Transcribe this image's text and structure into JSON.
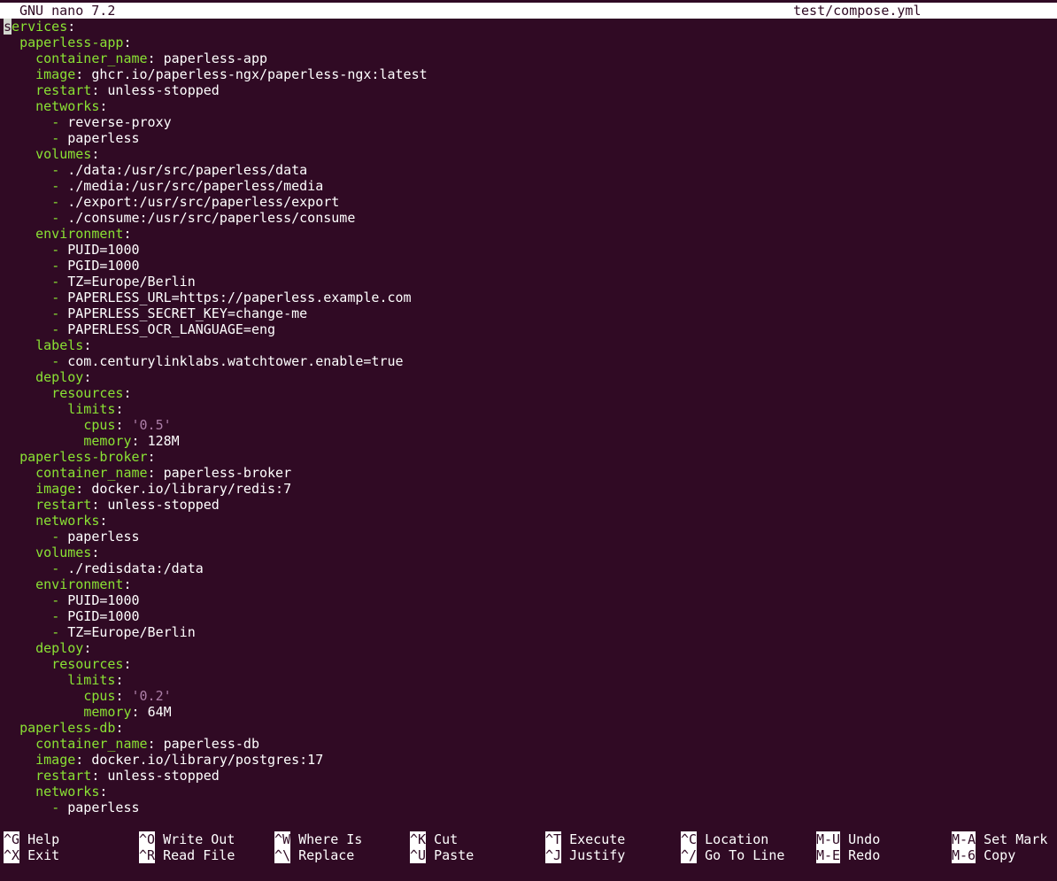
{
  "titlebar": {
    "app": "GNU nano 7.2",
    "file": "test/compose.yml"
  },
  "editor": {
    "lines": [
      [
        {
          "t": "s",
          "c": "cursor"
        },
        {
          "t": "ervices",
          "c": "k"
        },
        {
          "t": ":",
          "c": "p"
        }
      ],
      [
        {
          "t": "  "
        },
        {
          "t": "paperless-app",
          "c": "k"
        },
        {
          "t": ":",
          "c": "p"
        }
      ],
      [
        {
          "t": "    "
        },
        {
          "t": "container_name",
          "c": "k"
        },
        {
          "t": ": ",
          "c": "p"
        },
        {
          "t": "paperless-app",
          "c": "v"
        }
      ],
      [
        {
          "t": "    "
        },
        {
          "t": "image",
          "c": "k"
        },
        {
          "t": ": ",
          "c": "p"
        },
        {
          "t": "ghcr.io/paperless-ngx/paperless-ngx:latest",
          "c": "v"
        }
      ],
      [
        {
          "t": "    "
        },
        {
          "t": "restart",
          "c": "k"
        },
        {
          "t": ": ",
          "c": "p"
        },
        {
          "t": "unless-stopped",
          "c": "v"
        }
      ],
      [
        {
          "t": "    "
        },
        {
          "t": "networks",
          "c": "k"
        },
        {
          "t": ":",
          "c": "p"
        }
      ],
      [
        {
          "t": "      "
        },
        {
          "t": "-",
          "c": "d"
        },
        {
          "t": " reverse-proxy",
          "c": "v"
        }
      ],
      [
        {
          "t": "      "
        },
        {
          "t": "-",
          "c": "d"
        },
        {
          "t": " paperless",
          "c": "v"
        }
      ],
      [
        {
          "t": "    "
        },
        {
          "t": "volumes",
          "c": "k"
        },
        {
          "t": ":",
          "c": "p"
        }
      ],
      [
        {
          "t": "      "
        },
        {
          "t": "-",
          "c": "d"
        },
        {
          "t": " ./data:/usr/src/paperless/data",
          "c": "v"
        }
      ],
      [
        {
          "t": "      "
        },
        {
          "t": "-",
          "c": "d"
        },
        {
          "t": " ./media:/usr/src/paperless/media",
          "c": "v"
        }
      ],
      [
        {
          "t": "      "
        },
        {
          "t": "-",
          "c": "d"
        },
        {
          "t": " ./export:/usr/src/paperless/export",
          "c": "v"
        }
      ],
      [
        {
          "t": "      "
        },
        {
          "t": "-",
          "c": "d"
        },
        {
          "t": " ./consume:/usr/src/paperless/consume",
          "c": "v"
        }
      ],
      [
        {
          "t": "    "
        },
        {
          "t": "environment",
          "c": "k"
        },
        {
          "t": ":",
          "c": "p"
        }
      ],
      [
        {
          "t": "      "
        },
        {
          "t": "-",
          "c": "d"
        },
        {
          "t": " PUID=1000",
          "c": "v"
        }
      ],
      [
        {
          "t": "      "
        },
        {
          "t": "-",
          "c": "d"
        },
        {
          "t": " PGID=1000",
          "c": "v"
        }
      ],
      [
        {
          "t": "      "
        },
        {
          "t": "-",
          "c": "d"
        },
        {
          "t": " TZ=Europe/Berlin",
          "c": "v"
        }
      ],
      [
        {
          "t": "      "
        },
        {
          "t": "-",
          "c": "d"
        },
        {
          "t": " PAPERLESS_URL=https://paperless.example.com",
          "c": "v"
        }
      ],
      [
        {
          "t": "      "
        },
        {
          "t": "-",
          "c": "d"
        },
        {
          "t": " PAPERLESS_SECRET_KEY=change-me",
          "c": "v"
        }
      ],
      [
        {
          "t": "      "
        },
        {
          "t": "-",
          "c": "d"
        },
        {
          "t": " PAPERLESS_OCR_LANGUAGE=eng",
          "c": "v"
        }
      ],
      [
        {
          "t": "    "
        },
        {
          "t": "labels",
          "c": "k"
        },
        {
          "t": ":",
          "c": "p"
        }
      ],
      [
        {
          "t": "      "
        },
        {
          "t": "-",
          "c": "d"
        },
        {
          "t": " com.centurylinklabs.watchtower.enable=true",
          "c": "v"
        }
      ],
      [
        {
          "t": "    "
        },
        {
          "t": "deploy",
          "c": "k"
        },
        {
          "t": ":",
          "c": "p"
        }
      ],
      [
        {
          "t": "      "
        },
        {
          "t": "resources",
          "c": "k"
        },
        {
          "t": ":",
          "c": "p"
        }
      ],
      [
        {
          "t": "        "
        },
        {
          "t": "limits",
          "c": "k"
        },
        {
          "t": ":",
          "c": "p"
        }
      ],
      [
        {
          "t": "          "
        },
        {
          "t": "cpus",
          "c": "k"
        },
        {
          "t": ": ",
          "c": "p"
        },
        {
          "t": "'0.5'",
          "c": "s"
        }
      ],
      [
        {
          "t": "          "
        },
        {
          "t": "memory",
          "c": "k"
        },
        {
          "t": ": ",
          "c": "p"
        },
        {
          "t": "128M",
          "c": "v"
        }
      ],
      [
        {
          "t": "  "
        },
        {
          "t": "paperless-broker",
          "c": "k"
        },
        {
          "t": ":",
          "c": "p"
        }
      ],
      [
        {
          "t": "    "
        },
        {
          "t": "container_name",
          "c": "k"
        },
        {
          "t": ": ",
          "c": "p"
        },
        {
          "t": "paperless-broker",
          "c": "v"
        }
      ],
      [
        {
          "t": "    "
        },
        {
          "t": "image",
          "c": "k"
        },
        {
          "t": ": ",
          "c": "p"
        },
        {
          "t": "docker.io/library/redis:7",
          "c": "v"
        }
      ],
      [
        {
          "t": "    "
        },
        {
          "t": "restart",
          "c": "k"
        },
        {
          "t": ": ",
          "c": "p"
        },
        {
          "t": "unless-stopped",
          "c": "v"
        }
      ],
      [
        {
          "t": "    "
        },
        {
          "t": "networks",
          "c": "k"
        },
        {
          "t": ":",
          "c": "p"
        }
      ],
      [
        {
          "t": "      "
        },
        {
          "t": "-",
          "c": "d"
        },
        {
          "t": " paperless",
          "c": "v"
        }
      ],
      [
        {
          "t": "    "
        },
        {
          "t": "volumes",
          "c": "k"
        },
        {
          "t": ":",
          "c": "p"
        }
      ],
      [
        {
          "t": "      "
        },
        {
          "t": "-",
          "c": "d"
        },
        {
          "t": " ./redisdata:/data",
          "c": "v"
        }
      ],
      [
        {
          "t": "    "
        },
        {
          "t": "environment",
          "c": "k"
        },
        {
          "t": ":",
          "c": "p"
        }
      ],
      [
        {
          "t": "      "
        },
        {
          "t": "-",
          "c": "d"
        },
        {
          "t": " PUID=1000",
          "c": "v"
        }
      ],
      [
        {
          "t": "      "
        },
        {
          "t": "-",
          "c": "d"
        },
        {
          "t": " PGID=1000",
          "c": "v"
        }
      ],
      [
        {
          "t": "      "
        },
        {
          "t": "-",
          "c": "d"
        },
        {
          "t": " TZ=Europe/Berlin",
          "c": "v"
        }
      ],
      [
        {
          "t": "    "
        },
        {
          "t": "deploy",
          "c": "k"
        },
        {
          "t": ":",
          "c": "p"
        }
      ],
      [
        {
          "t": "      "
        },
        {
          "t": "resources",
          "c": "k"
        },
        {
          "t": ":",
          "c": "p"
        }
      ],
      [
        {
          "t": "        "
        },
        {
          "t": "limits",
          "c": "k"
        },
        {
          "t": ":",
          "c": "p"
        }
      ],
      [
        {
          "t": "          "
        },
        {
          "t": "cpus",
          "c": "k"
        },
        {
          "t": ": ",
          "c": "p"
        },
        {
          "t": "'0.2'",
          "c": "s"
        }
      ],
      [
        {
          "t": "          "
        },
        {
          "t": "memory",
          "c": "k"
        },
        {
          "t": ": ",
          "c": "p"
        },
        {
          "t": "64M",
          "c": "v"
        }
      ],
      [
        {
          "t": "  "
        },
        {
          "t": "paperless-db",
          "c": "k"
        },
        {
          "t": ":",
          "c": "p"
        }
      ],
      [
        {
          "t": "    "
        },
        {
          "t": "container_name",
          "c": "k"
        },
        {
          "t": ": ",
          "c": "p"
        },
        {
          "t": "paperless-db",
          "c": "v"
        }
      ],
      [
        {
          "t": "    "
        },
        {
          "t": "image",
          "c": "k"
        },
        {
          "t": ": ",
          "c": "p"
        },
        {
          "t": "docker.io/library/postgres:17",
          "c": "v"
        }
      ],
      [
        {
          "t": "    "
        },
        {
          "t": "restart",
          "c": "k"
        },
        {
          "t": ": ",
          "c": "p"
        },
        {
          "t": "unless-stopped",
          "c": "v"
        }
      ],
      [
        {
          "t": "    "
        },
        {
          "t": "networks",
          "c": "k"
        },
        {
          "t": ":",
          "c": "p"
        }
      ],
      [
        {
          "t": "      "
        },
        {
          "t": "-",
          "c": "d"
        },
        {
          "t": " paperless",
          "c": "v"
        }
      ]
    ]
  },
  "shortcuts": {
    "row1": [
      {
        "key": "^G",
        "label": "Help"
      },
      {
        "key": "^O",
        "label": "Write Out"
      },
      {
        "key": "^W",
        "label": "Where Is"
      },
      {
        "key": "^K",
        "label": "Cut"
      },
      {
        "key": "^T",
        "label": "Execute"
      },
      {
        "key": "^C",
        "label": "Location"
      },
      {
        "key": "M-U",
        "label": "Undo"
      },
      {
        "key": "M-A",
        "label": "Set Mark"
      }
    ],
    "row2": [
      {
        "key": "^X",
        "label": "Exit"
      },
      {
        "key": "^R",
        "label": "Read File"
      },
      {
        "key": "^\\",
        "label": "Replace"
      },
      {
        "key": "^U",
        "label": "Paste"
      },
      {
        "key": "^J",
        "label": "Justify"
      },
      {
        "key": "^/",
        "label": "Go To Line"
      },
      {
        "key": "M-E",
        "label": "Redo"
      },
      {
        "key": "M-6",
        "label": "Copy"
      }
    ]
  },
  "colors": {
    "background": "#300a24",
    "key_color": "#8ae234",
    "string_color": "#ad7fa8",
    "text": "#ffffff"
  }
}
